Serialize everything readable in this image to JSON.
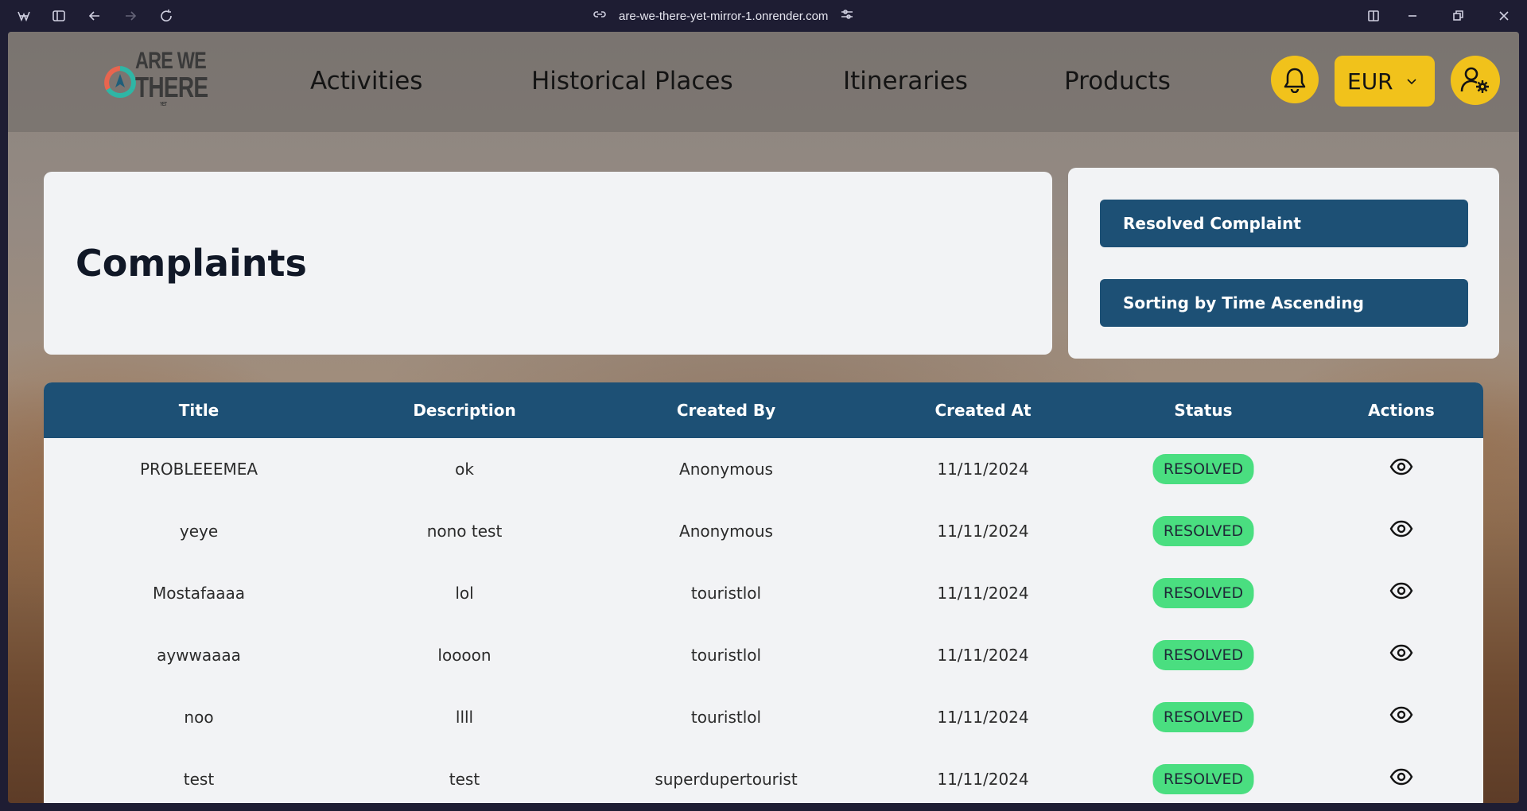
{
  "browser": {
    "url": "are-we-there-yet-mirror-1.onrender.com"
  },
  "brand": {
    "logo_line1": "ARE WE",
    "logo_line2": "THERE",
    "logo_small": "YET"
  },
  "nav": {
    "links": [
      "Activities",
      "Historical Places",
      "Itineraries",
      "Products"
    ],
    "currency": "EUR"
  },
  "page": {
    "title": "Complaints"
  },
  "filters": {
    "status_button": "Resolved Complaint",
    "sort_button": "Sorting by Time Ascending"
  },
  "table": {
    "headers": [
      "Title",
      "Description",
      "Created By",
      "Created At",
      "Status",
      "Actions"
    ],
    "rows": [
      {
        "title": "PROBLEEEMEA",
        "description": "ok",
        "created_by": "Anonymous",
        "created_at": "11/11/2024",
        "status": "RESOLVED"
      },
      {
        "title": "yeye",
        "description": "nono test",
        "created_by": "Anonymous",
        "created_at": "11/11/2024",
        "status": "RESOLVED"
      },
      {
        "title": "Mostafaaaa",
        "description": "lol",
        "created_by": "touristlol",
        "created_at": "11/11/2024",
        "status": "RESOLVED"
      },
      {
        "title": "aywwaaaa",
        "description": "loooon",
        "created_by": "touristlol",
        "created_at": "11/11/2024",
        "status": "RESOLVED"
      },
      {
        "title": "noo",
        "description": "llll",
        "created_by": "touristlol",
        "created_at": "11/11/2024",
        "status": "RESOLVED"
      },
      {
        "title": "test",
        "description": "test",
        "created_by": "superdupertourist",
        "created_at": "11/11/2024",
        "status": "RESOLVED"
      }
    ]
  },
  "colors": {
    "accent_yellow": "#f1c21b",
    "header_blue": "#1d5075",
    "status_green": "#4ade80"
  }
}
